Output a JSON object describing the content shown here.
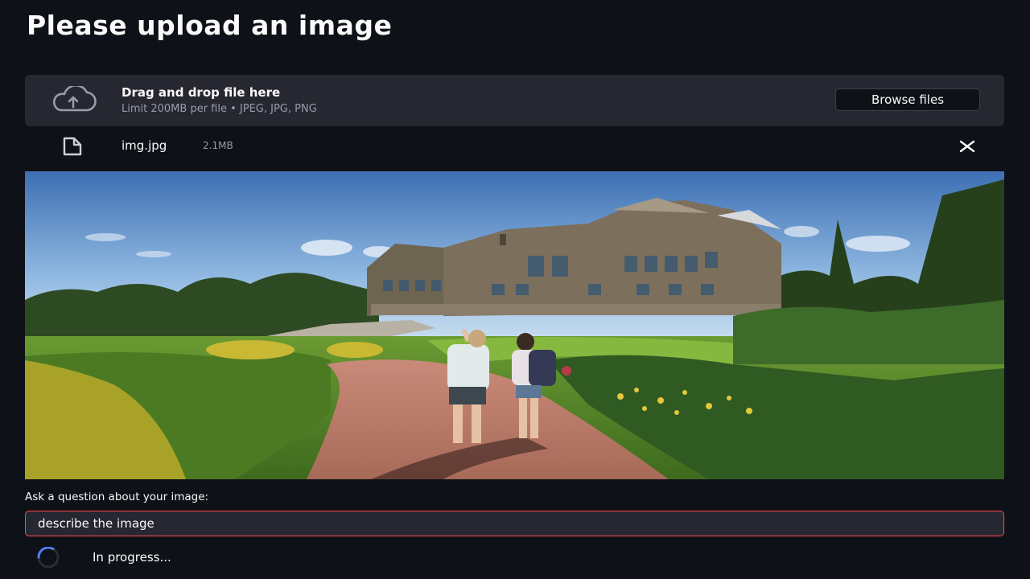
{
  "page": {
    "title": "Please upload an image"
  },
  "uploader": {
    "drop_label": "Drag and drop file here",
    "limit_label": "Limit 200MB per file • JPEG, JPG, PNG",
    "browse_label": "Browse files",
    "icon": "cloud-upload-icon"
  },
  "file": {
    "name": "img.jpg",
    "size": "2.1MB",
    "icon": "file-icon",
    "remove_icon": "close-icon"
  },
  "preview": {
    "scene": "Couple walking hand in hand on a brick path toward a large manor house in a garden park"
  },
  "question": {
    "label": "Ask a question about your image:",
    "value": "describe the image"
  },
  "status": {
    "text": "In progress..."
  },
  "colors": {
    "background": "#0e1117",
    "panel": "#262730",
    "accent": "#ff4b4b",
    "spinner": "#4f7df3"
  }
}
